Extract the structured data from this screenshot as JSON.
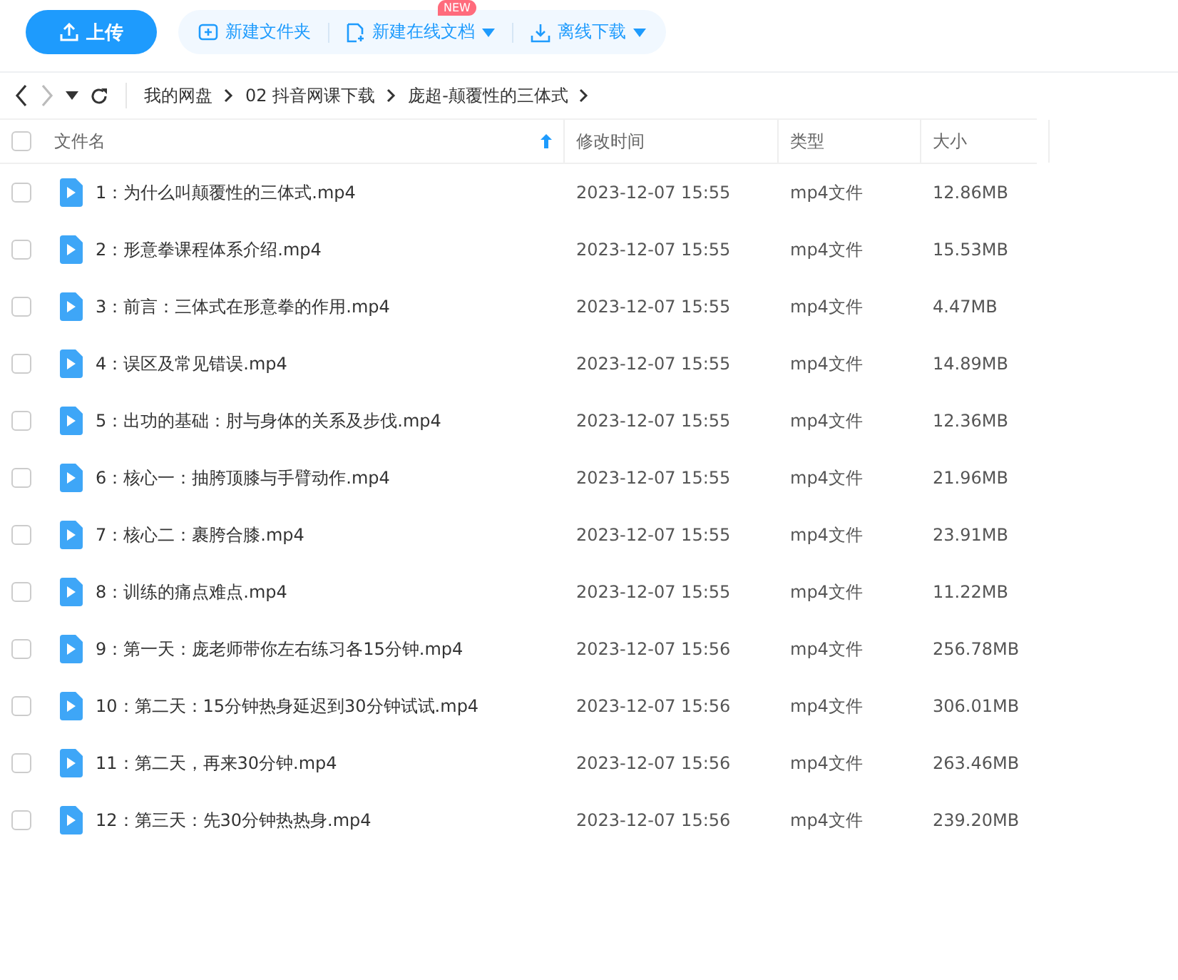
{
  "toolbar": {
    "upload_button": "上传",
    "actions": [
      {
        "kind": "folder",
        "label": "新建文件夹",
        "dropdown": false
      },
      {
        "kind": "doc",
        "label": "新建在线文档",
        "dropdown": true,
        "badge": "NEW"
      },
      {
        "kind": "download",
        "label": "离线下载",
        "dropdown": true
      }
    ]
  },
  "breadcrumb": [
    {
      "label": "我的网盘"
    },
    {
      "label": "02 抖音网课下载"
    },
    {
      "label": "庞超-颠覆性的三体式"
    }
  ],
  "table": {
    "select_all": {
      "checked": false
    },
    "columns": [
      {
        "label": "文件名",
        "sorted": true
      },
      {
        "label": "修改时间",
        "sorted": false
      },
      {
        "label": "类型",
        "sorted": false
      },
      {
        "label": "大小",
        "sorted": false
      }
    ],
    "rows": [
      {
        "checked": false,
        "name": "1：为什么叫颠覆性的三体式.mp4",
        "time": "2023-12-07 15:55",
        "type": "mp4文件",
        "size": "12.86MB"
      },
      {
        "checked": false,
        "name": "2：形意拳课程体系介绍.mp4",
        "time": "2023-12-07 15:55",
        "type": "mp4文件",
        "size": "15.53MB"
      },
      {
        "checked": false,
        "name": "3：前言：三体式在形意拳的作用.mp4",
        "time": "2023-12-07 15:55",
        "type": "mp4文件",
        "size": "4.47MB"
      },
      {
        "checked": false,
        "name": "4：误区及常见错误.mp4",
        "time": "2023-12-07 15:55",
        "type": "mp4文件",
        "size": "14.89MB"
      },
      {
        "checked": false,
        "name": "5：出功的基础：肘与身体的关系及步伐.mp4",
        "time": "2023-12-07 15:55",
        "type": "mp4文件",
        "size": "12.36MB"
      },
      {
        "checked": false,
        "name": "6：核心一：抽胯顶膝与手臂动作.mp4",
        "time": "2023-12-07 15:55",
        "type": "mp4文件",
        "size": "21.96MB"
      },
      {
        "checked": false,
        "name": "7：核心二：裹胯合膝.mp4",
        "time": "2023-12-07 15:55",
        "type": "mp4文件",
        "size": "23.91MB"
      },
      {
        "checked": false,
        "name": "8：训练的痛点难点.mp4",
        "time": "2023-12-07 15:55",
        "type": "mp4文件",
        "size": "11.22MB"
      },
      {
        "checked": false,
        "name": "9：第一天：庞老师带你左右练习各15分钟.mp4",
        "time": "2023-12-07 15:56",
        "type": "mp4文件",
        "size": "256.78MB"
      },
      {
        "checked": false,
        "name": "10：第二天：15分钟热身延迟到30分钟试试.mp4",
        "time": "2023-12-07 15:56",
        "type": "mp4文件",
        "size": "306.01MB"
      },
      {
        "checked": false,
        "name": "11：第二天，再来30分钟.mp4",
        "time": "2023-12-07 15:56",
        "type": "mp4文件",
        "size": "263.46MB"
      },
      {
        "checked": false,
        "name": "12：第三天：先30分钟热热身.mp4",
        "time": "2023-12-07 15:56",
        "type": "mp4文件",
        "size": "239.20MB"
      }
    ]
  }
}
